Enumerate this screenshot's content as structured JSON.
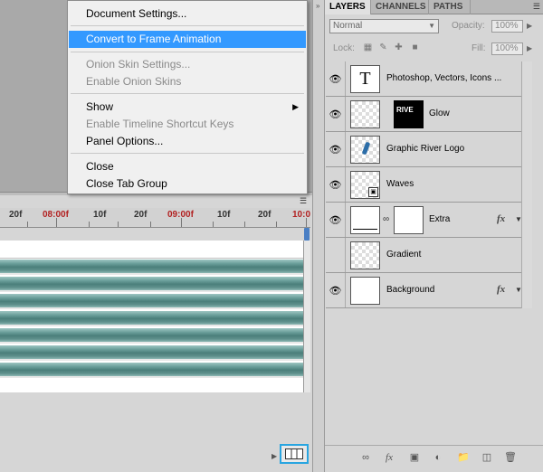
{
  "context_menu": {
    "items": [
      {
        "label": "Document Settings...",
        "state": "normal"
      },
      {
        "label": "Convert to Frame Animation",
        "state": "highlighted"
      },
      {
        "label": "Onion Skin Settings...",
        "state": "disabled"
      },
      {
        "label": "Enable Onion Skins",
        "state": "disabled"
      },
      {
        "label": "Show",
        "state": "normal",
        "submenu": true
      },
      {
        "label": "Enable Timeline Shortcut Keys",
        "state": "disabled"
      },
      {
        "label": "Panel Options...",
        "state": "normal"
      },
      {
        "label": "Close",
        "state": "normal"
      },
      {
        "label": "Close Tab Group",
        "state": "normal"
      }
    ]
  },
  "timeline": {
    "ruler_labels": [
      "20f",
      "08:00f",
      "10f",
      "20f",
      "09:00f",
      "10f",
      "20f",
      "10:0"
    ],
    "highlighted_button": "convert-to-frame-animation"
  },
  "layers_panel": {
    "tabs": [
      "LAYERS",
      "CHANNELS",
      "PATHS"
    ],
    "active_tab": "LAYERS",
    "blend_mode": "Normal",
    "opacity_label": "Opacity:",
    "opacity_value": "100%",
    "lock_label": "Lock:",
    "fill_label": "Fill:",
    "fill_value": "100%",
    "layers": [
      {
        "name": "Photoshop, Vectors, Icons  ...",
        "thumb": "text",
        "thumb_text": "T",
        "fx": false
      },
      {
        "name": "Glow",
        "thumb": "mask",
        "mask_text": "RIVE",
        "fx": false
      },
      {
        "name": "Graphic River Logo",
        "thumb": "logo",
        "fx": false
      },
      {
        "name": "Waves",
        "thumb": "smart",
        "fx": false
      },
      {
        "name": "Extra",
        "thumb": "adjustment",
        "fx": true
      },
      {
        "name": "Gradient",
        "thumb": "transparent",
        "fx": false
      },
      {
        "name": "Background",
        "thumb": "white",
        "fx": true
      }
    ],
    "fx_label": "fx"
  },
  "colors": {
    "highlight": "#3399ff",
    "timeline_bar": "#5f908c",
    "focus_ring": "#29a5e0"
  }
}
